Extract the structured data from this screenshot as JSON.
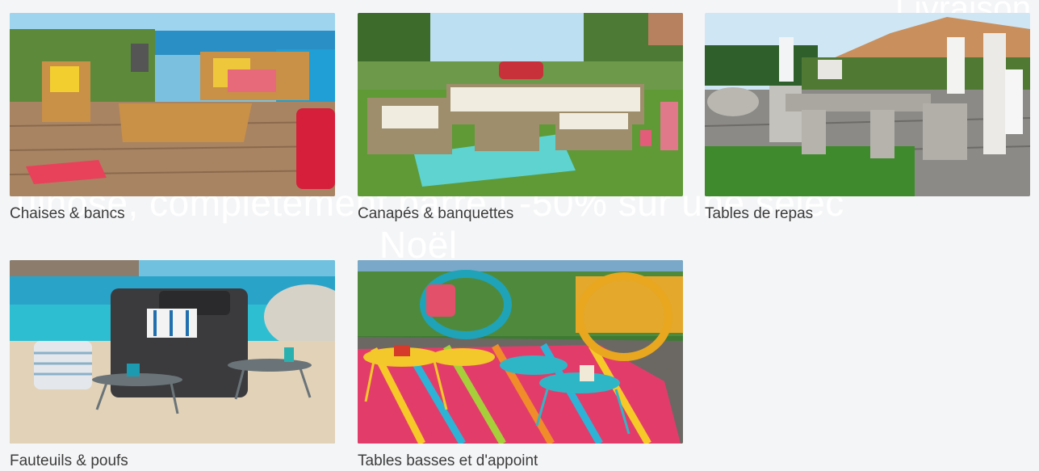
{
  "background": {
    "banner_line1": "ulnose, complètement barré ! -50% sur une sélec",
    "banner_line2": "Noël",
    "corner_text": "Livraison"
  },
  "categories": [
    {
      "label": "Chaises & bancs"
    },
    {
      "label": "Canapés & banquettes"
    },
    {
      "label": "Tables de repas"
    },
    {
      "label": "Fauteuils & poufs"
    },
    {
      "label": "Tables basses et d'appoint"
    }
  ],
  "colors": {
    "label_text": "#3c3c3c",
    "page_bg": "#f4f5f7"
  }
}
